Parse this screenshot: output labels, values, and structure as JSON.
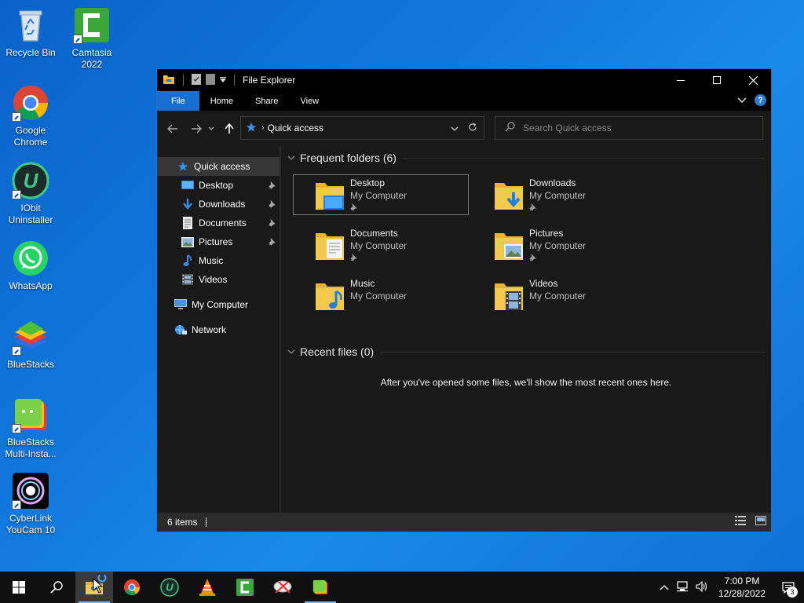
{
  "desktop": {
    "icons": [
      {
        "label": "Recycle Bin",
        "icon": "recycle-bin-icon"
      },
      {
        "label": "Camtasia\n2022",
        "icon": "camtasia-icon"
      },
      {
        "label": "Google\nChrome",
        "icon": "chrome-icon"
      },
      {
        "label": "IObit\nUninstaller",
        "icon": "iobit-icon"
      },
      {
        "label": "WhatsApp",
        "icon": "whatsapp-icon"
      },
      {
        "label": "BlueStacks",
        "icon": "bluestacks-icon"
      },
      {
        "label": "BlueStacks\nMulti-Insta...",
        "icon": "bluestacks-multi-icon"
      },
      {
        "label": "CyberLink\nYouCam 10",
        "icon": "youcam-icon"
      }
    ]
  },
  "explorer": {
    "title": "File Explorer",
    "ribbon_tabs": [
      "File",
      "Home",
      "Share",
      "View"
    ],
    "address": "Quick access",
    "search_placeholder": "Search Quick access",
    "sidebar": {
      "quick_access": "Quick access",
      "items": [
        {
          "label": "Desktop",
          "pinned": true
        },
        {
          "label": "Downloads",
          "pinned": true
        },
        {
          "label": "Documents",
          "pinned": true
        },
        {
          "label": "Pictures",
          "pinned": true
        },
        {
          "label": "Music",
          "pinned": false
        },
        {
          "label": "Videos",
          "pinned": false
        }
      ],
      "my_computer": "My Computer",
      "network": "Network"
    },
    "frequent_header": "Frequent folders (6)",
    "folders": [
      {
        "name": "Desktop",
        "location": "My Computer",
        "pinned": true
      },
      {
        "name": "Downloads",
        "location": "My Computer",
        "pinned": true
      },
      {
        "name": "Documents",
        "location": "My Computer",
        "pinned": true
      },
      {
        "name": "Pictures",
        "location": "My Computer",
        "pinned": true
      },
      {
        "name": "Music",
        "location": "My Computer",
        "pinned": false
      },
      {
        "name": "Videos",
        "location": "My Computer",
        "pinned": false
      }
    ],
    "recent_header": "Recent files (0)",
    "recent_empty": "After you've opened some files, we'll show the most recent ones here.",
    "status": "6 items"
  },
  "taskbar": {
    "time": "7:00 PM",
    "date": "12/28/2022",
    "notification_count": "3"
  },
  "colors": {
    "accent": "#1a6fce",
    "window_bg": "#191919",
    "folder_yellow": "#f2c94c"
  }
}
